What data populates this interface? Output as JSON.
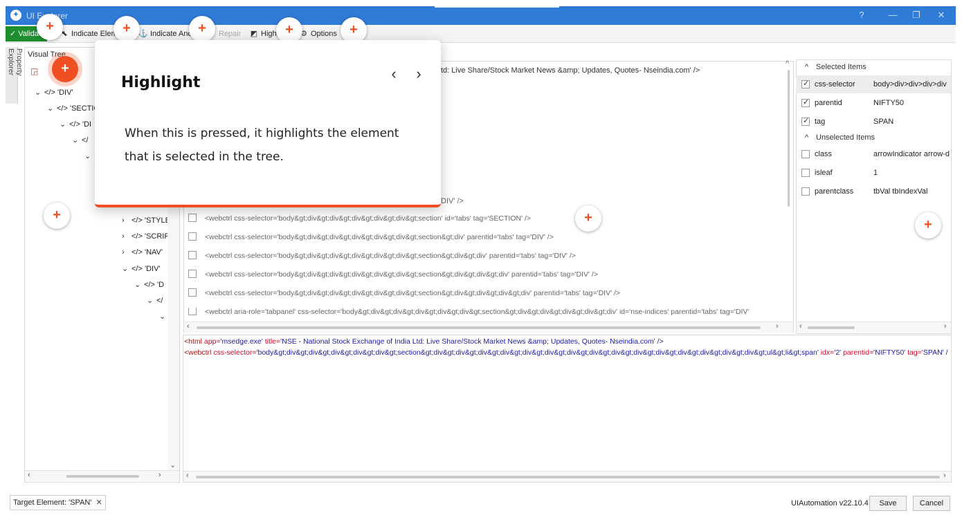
{
  "window": {
    "title": "UI Explorer",
    "controls": {
      "help": "?",
      "minimize": "—",
      "restore": "❐",
      "close": "✕"
    }
  },
  "toolbar": {
    "validate": "Validate",
    "indicate_element": "Indicate Element",
    "indicate_anchor": "Indicate Anchor",
    "repair": "Repair",
    "highlight": "Highlight",
    "options": "Options"
  },
  "sidebar_tab": "Property Explorer",
  "visual_tree": {
    "label": "Visual Tree",
    "rows": [
      "'DIV'",
      "'SECTIO",
      "'DI",
      "",
      "",
      "'STYLE",
      "'SCRIP",
      "'NAV'",
      "'DIV'",
      "'D",
      "",
      ""
    ]
  },
  "selector_panel": {
    "header_fragment": "td: Live Share/Stock Market News &amp; Updates, Quotes- Nseindia.com' />",
    "row_fragment": "DIV' />",
    "rows": [
      "<webctrl css-selector='body&gt;div&gt;div&gt;div&gt;div&gt;div&gt;section' id='tabs' tag='SECTION' />",
      "<webctrl css-selector='body&gt;div&gt;div&gt;div&gt;div&gt;div&gt;section&gt;div' parentid='tabs' tag='DIV' />",
      "<webctrl css-selector='body&gt;div&gt;div&gt;div&gt;div&gt;div&gt;section&gt;div&gt;div' parentid='tabs' tag='DIV' />",
      "<webctrl css-selector='body&gt;div&gt;div&gt;div&gt;div&gt;div&gt;section&gt;div&gt;div&gt;div' parentid='tabs' tag='DIV' />",
      "<webctrl css-selector='body&gt;div&gt;div&gt;div&gt;div&gt;div&gt;section&gt;div&gt;div&gt;div&gt;div' parentid='tabs' tag='DIV' />",
      "<webctrl aria-role='tabpanel' css-selector='body&gt;div&gt;div&gt;div&gt;div&gt;div&gt;section&gt;div&gt;div&gt;div&gt;div&gt;div' id='nse-indices' parentid='tabs' tag='DIV'"
    ]
  },
  "attributes": {
    "selected_header": "Selected Items",
    "unselected_header": "Unselected Items",
    "selected": [
      {
        "name": "css-selector",
        "value": "body>div>div>div>div"
      },
      {
        "name": "parentid",
        "value": "NIFTY50"
      },
      {
        "name": "tag",
        "value": "SPAN"
      }
    ],
    "unselected": [
      {
        "name": "class",
        "value": "arrowIndicator arrow-down"
      },
      {
        "name": "isleaf",
        "value": "1"
      },
      {
        "name": "parentclass",
        "value": "tbVal tbIndexVal"
      }
    ]
  },
  "selector_editor": {
    "line1": {
      "tag": "<html ",
      "a1": "app=",
      "v1": "'msedge.exe' ",
      "a2": "title=",
      "v2": "'NSE - National Stock Exchange of India Ltd: Live Share/Stock Market News &amp; Updates, Quotes- Nseindia.com' />"
    },
    "line2": {
      "tag": "<webctrl ",
      "a1": "css-selector=",
      "v1": "'body&gt;div&gt;div&gt;div&gt;div&gt;div&gt;section&gt;div&gt;div&gt;div&gt;div&gt;div&gt;div&gt;div&gt;div&gt;div&gt;div&gt;div&gt;div&gt;div&gt;div&gt;div&gt;ul&gt;li&gt;span' ",
      "a2": "idx=",
      "v2": "'2' ",
      "a3": "parentid=",
      "v3": "'NIFTY50' ",
      "a4": "tag=",
      "v4": "'SPAN' /"
    }
  },
  "status": {
    "target_element": "Target Element: 'SPAN'",
    "version": "UIAutomation v22.10.4",
    "save": "Save",
    "cancel": "Cancel"
  },
  "tooltip": {
    "title": "Highlight",
    "body": "When this is pressed, it highlights the element that is selected in the tree.",
    "prev": "‹",
    "next": "›"
  },
  "colors": {
    "accent": "#f04e23",
    "titlebar": "#2f7bd6",
    "validate": "#1d8f2f"
  }
}
